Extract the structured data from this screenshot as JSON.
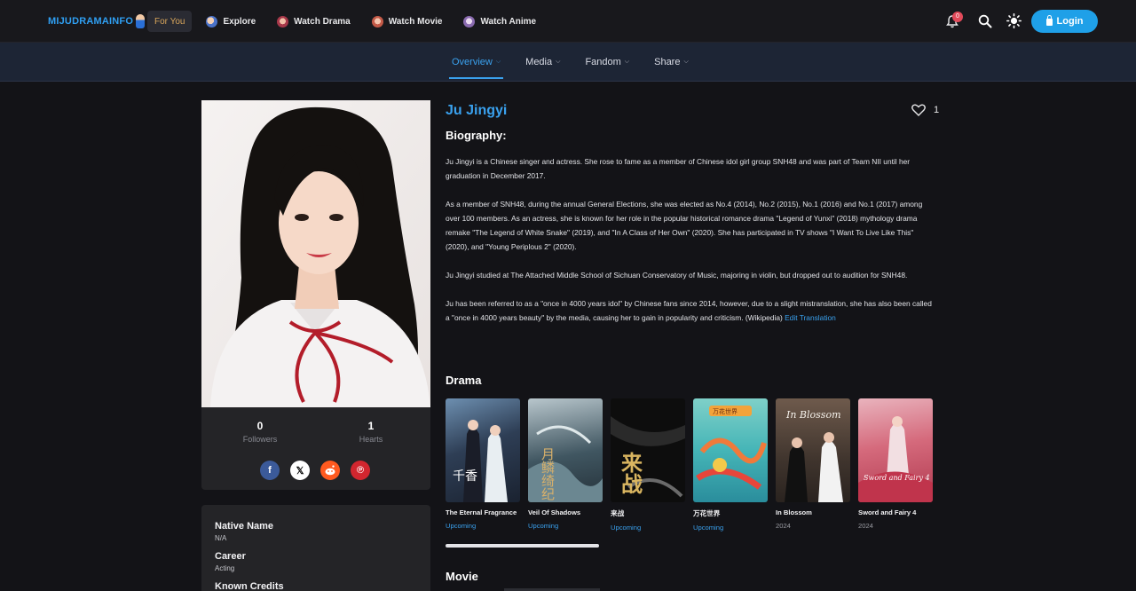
{
  "brand": {
    "logo_text": "MIJUDRAMAINFO"
  },
  "topnav": {
    "items": [
      {
        "label": "For You"
      },
      {
        "label": "Explore"
      },
      {
        "label": "Watch Drama"
      },
      {
        "label": "Watch Movie"
      },
      {
        "label": "Watch Anime"
      }
    ],
    "notification_count": "0",
    "login_label": "Login"
  },
  "subnav": {
    "tabs": [
      {
        "label": "Overview"
      },
      {
        "label": "Media"
      },
      {
        "label": "Fandom"
      },
      {
        "label": "Share"
      }
    ]
  },
  "profile": {
    "name": "Ju Jingyi",
    "likes": "1",
    "stats": [
      {
        "value": "0",
        "label": "Followers"
      },
      {
        "value": "1",
        "label": "Hearts"
      }
    ],
    "info": [
      {
        "label": "Native Name",
        "value": "N/A"
      },
      {
        "label": "Career",
        "value": "Acting"
      },
      {
        "label": "Known Credits",
        "value": ""
      }
    ]
  },
  "biography": {
    "heading": "Biography:",
    "paragraphs": [
      "Ju Jingyi is a Chinese singer and actress. She rose to fame as a member of Chinese idol girl group SNH48 and was part of Team NII until her graduation in December 2017.",
      "As a member of SNH48, during the annual General Elections, she was elected as No.4 (2014), No.2 (2015), No.1 (2016) and No.1 (2017) among over 100 members. As an actress, she is known for her role in the popular historical romance drama \"Legend of Yunxi\" (2018) mythology drama remake \"The Legend of White Snake\" (2019), and \"In A Class of Her Own\" (2020). She has participated in TV shows \"I Want To Live Like This\" (2020), and \"Young Periplous 2\" (2020).",
      "Ju Jingyi studied at The Attached Middle School of Sichuan Conservatory of Music, majoring in violin, but dropped out to audition for SNH48."
    ],
    "last_paragraph": "Ju has been referred to as a \"once in 4000 years idol\" by Chinese fans since 2014, however, due to a slight mistranslation, she has also been called a \"once in 4000 years beauty\" by the media, causing her to gain in popularity and criticism. (Wikipedia)",
    "edit_link": "Edit Translation"
  },
  "drama": {
    "heading": "Drama",
    "items": [
      {
        "title": "The Eternal Fragrance",
        "status": "Upcoming",
        "poster_text": "千香"
      },
      {
        "title": "Veil Of Shadows",
        "status": "Upcoming",
        "poster_text": "月鳞绮纪"
      },
      {
        "title": "来战",
        "status": "Upcoming",
        "poster_text": "来战"
      },
      {
        "title": "万花世界",
        "status": "Upcoming",
        "poster_text": "万花世界"
      },
      {
        "title": "In Blossom",
        "status": "2024",
        "poster_text": "In Blossom"
      },
      {
        "title": "Sword and Fairy 4",
        "status": "2024",
        "poster_text": "Sword and Fairy 4"
      }
    ]
  },
  "movie": {
    "heading": "Movie"
  }
}
